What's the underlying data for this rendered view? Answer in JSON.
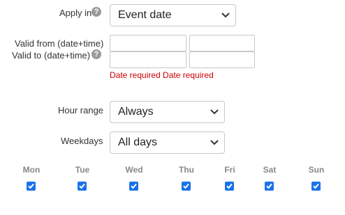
{
  "apply_in": {
    "label": "Apply in",
    "help": "?",
    "value": "Event date"
  },
  "valid": {
    "from_label": "Valid from (date+time)",
    "to_label": "Valid to (date+time)",
    "help": "?",
    "error": "Date required Date required",
    "from_date": "",
    "from_time": "",
    "to_date": "",
    "to_time": ""
  },
  "hour_range": {
    "label": "Hour range",
    "value": "Always"
  },
  "weekdays": {
    "label": "Weekdays",
    "value": "All days"
  },
  "days": [
    {
      "label": "Mon",
      "checked": true
    },
    {
      "label": "Tue",
      "checked": true
    },
    {
      "label": "Wed",
      "checked": true
    },
    {
      "label": "Thu",
      "checked": true
    },
    {
      "label": "Fri",
      "checked": true
    },
    {
      "label": "Sat",
      "checked": true
    },
    {
      "label": "Sun",
      "checked": true
    }
  ],
  "colors": {
    "error": "#cc0000",
    "checkbox": "#1a73e8",
    "day_label": "#888888"
  }
}
